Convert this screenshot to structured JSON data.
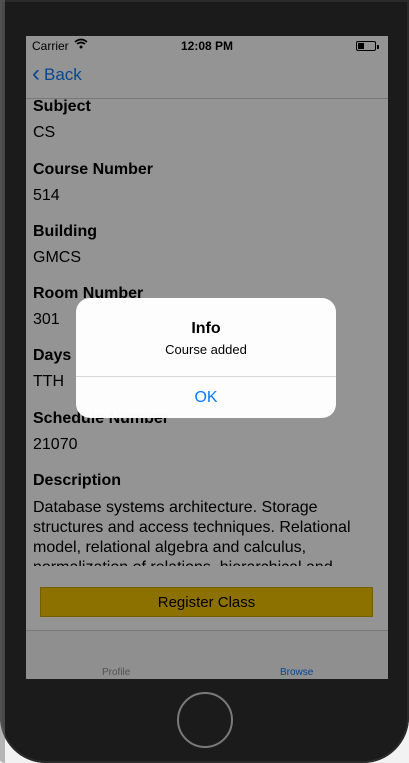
{
  "status": {
    "carrier": "Carrier",
    "wifi_icon": "wifi-icon",
    "time": "12:08 PM",
    "battery_icon": "battery-icon"
  },
  "nav": {
    "back_label": "Back",
    "back_icon": "chevron-left-icon"
  },
  "course": {
    "subject_label": "Subject",
    "subject_value": "CS",
    "course_number_label": "Course Number",
    "course_number_value": "514",
    "building_label": "Building",
    "building_value": "GMCS",
    "room_number_label": "Room Number",
    "room_number_value": "301",
    "days_label": "Days",
    "days_value": "TTH",
    "schedule_number_label": "Schedule Number",
    "schedule_number_value": "21070",
    "description_label": "Description",
    "description_value": "Database systems architecture. Storage structures and access techniques. Relational model, relational algebra and calculus, normalization of relations, hierarchical and"
  },
  "actions": {
    "register_label": "Register Class"
  },
  "tabs": [
    {
      "label": "Profile"
    },
    {
      "label": "Browse"
    }
  ],
  "alert": {
    "title": "Info",
    "message": "Course added",
    "ok_label": "OK"
  },
  "colors": {
    "accent": "#0a7aff",
    "register_button": "#f2c200",
    "overlay": "rgba(0,0,0,0.42)"
  }
}
